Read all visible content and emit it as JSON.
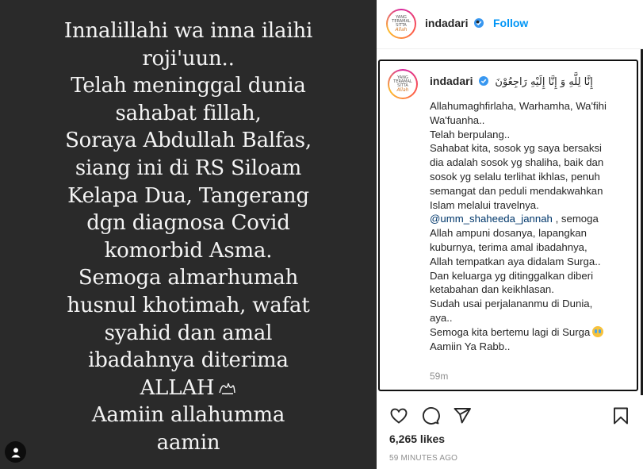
{
  "post_image": {
    "lines": [
      "Innalillahi wa inna ilaihi",
      "roji'uun..",
      "Telah meninggal dunia",
      "sahabat fillah,",
      "Soraya Abdullah Balfas,",
      "siang ini di RS Siloam",
      "Kelapa Dua, Tangerang",
      "dgn diagnosa Covid",
      "komorbid Asma.",
      "Semoga almarhumah",
      "husnul khotimah, wafat",
      "syahid dan amal",
      "ibadahnya diterima",
      "ALLAH",
      "Aamiin allahumma",
      "aamin"
    ],
    "allah_glyph": "جل جلاله"
  },
  "header": {
    "username": "indadari",
    "separator": "•",
    "follow_label": "Follow",
    "avatar_lines": [
      "YANG",
      "TERAMAL",
      "SITTA",
      "Allah"
    ]
  },
  "caption": {
    "username": "indadari",
    "arabic": "إِنَّا لِلَّهِ وَ إِنَّا إِلَيْهِ رَاجِعُوْنَ",
    "lines": [
      "Allahumaghfirlaha, Warhamha, Wa'fihi",
      "Wa'fuanha..",
      "Telah berpulang..",
      "Sahabat kita, sosok yg saya bersaksi",
      "dia adalah sosok yg shaliha, baik dan",
      "sosok yg selalu terlihat ikhlas, penuh",
      "semangat dan peduli mendakwahkan",
      "Islam melalui travelnya.",
      "",
      "Allah ampuni dosanya, lapangkan",
      "kuburnya, terima amal ibadahnya,",
      "Allah tempatkan aya didalam Surga..",
      "Dan keluarga yg ditinggalkan diberi",
      "ketabahan dan keikhlasan.",
      "Sudah usai perjalananmu di Dunia,",
      "aya..",
      "Semoga kita bertemu lagi di Surga",
      "Aamiin Ya Rabb.."
    ],
    "mention": "@umm_shaheeda_jannah",
    "mention_suffix": " , semoga",
    "time": "59m"
  },
  "footer": {
    "likes": "6,265 likes",
    "timestamp": "59 MINUTES AGO"
  },
  "colors": {
    "photo_bg": "#2a2a2a",
    "link_blue": "#0095f6",
    "mention": "#00376b"
  }
}
